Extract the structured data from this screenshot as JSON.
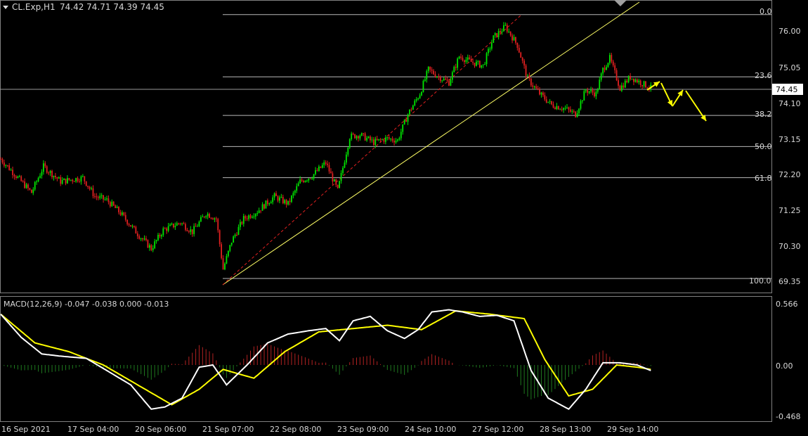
{
  "header": {
    "symbol": "CL.Exp,H1",
    "ohlc": "74.42 74.71 74.39 74.45"
  },
  "colors": {
    "background": "#000000",
    "bull": "#00e600",
    "bear": "#e02020",
    "fib": "#b8b8b8",
    "trend": "#ffff66",
    "signal": "#ffff00",
    "macd_line": "#ffffff",
    "hist_pos": "#b22222",
    "hist_neg": "#1f7a1f",
    "text": "#d8d8d8",
    "price_box_bg": "#ffffff"
  },
  "price_axis": {
    "ticks": [
      "76.00",
      "75.05",
      "74.10",
      "73.15",
      "72.20",
      "71.25",
      "70.30",
      "69.35"
    ],
    "current": "74.45"
  },
  "fib_levels": [
    "0.0",
    "23.6",
    "38.2",
    "50.0",
    "61.8",
    "100.0"
  ],
  "macd": {
    "label": "MACD(12,26,9) -0.047 -0.038 0.000 -0.013",
    "ticks": [
      "0.566",
      "0.00",
      "-0.468"
    ]
  },
  "time_axis": {
    "labels": [
      "16 Sep 2021",
      "17 Sep 04:00",
      "20 Sep 06:00",
      "21 Sep 07:00",
      "22 Sep 08:00",
      "23 Sep 09:00",
      "24 Sep 10:00",
      "27 Sep 12:00",
      "28 Sep 13:00",
      "29 Sep 14:00"
    ]
  },
  "chart_data": {
    "type": "candlestick",
    "price_range": [
      69.35,
      76.3
    ],
    "fib_retracement": {
      "levels": [
        0.0,
        23.6,
        38.2,
        50.0,
        61.8,
        100.0
      ],
      "high": 76.42,
      "low": 69.35
    },
    "trend_line": {
      "from": {
        "bar": 0,
        "price": 69.35
      },
      "to": {
        "bar": 1,
        "price": 76.85
      }
    },
    "close_path": [
      [
        0,
        72.55
      ],
      [
        10,
        72.05
      ],
      [
        18,
        71.65
      ],
      [
        25,
        72.35
      ],
      [
        35,
        71.95
      ],
      [
        48,
        72.05
      ],
      [
        55,
        71.55
      ],
      [
        62,
        71.45
      ],
      [
        70,
        71.1
      ],
      [
        80,
        70.55
      ],
      [
        88,
        70.15
      ],
      [
        95,
        70.65
      ],
      [
        105,
        70.85
      ],
      [
        112,
        70.6
      ],
      [
        120,
        71.1
      ],
      [
        126,
        70.95
      ],
      [
        130,
        69.6
      ],
      [
        135,
        70.35
      ],
      [
        142,
        70.95
      ],
      [
        150,
        71.15
      ],
      [
        160,
        71.55
      ],
      [
        168,
        71.35
      ],
      [
        175,
        71.95
      ],
      [
        182,
        72.1
      ],
      [
        190,
        72.45
      ],
      [
        197,
        71.7
      ],
      [
        204,
        73.15
      ],
      [
        210,
        73.2
      ],
      [
        218,
        73.0
      ],
      [
        226,
        73.1
      ],
      [
        232,
        73.05
      ],
      [
        238,
        73.75
      ],
      [
        245,
        74.3
      ],
      [
        250,
        74.95
      ],
      [
        256,
        74.75
      ],
      [
        262,
        74.6
      ],
      [
        268,
        75.3
      ],
      [
        275,
        75.15
      ],
      [
        282,
        75.05
      ],
      [
        288,
        75.8
      ],
      [
        295,
        76.1
      ],
      [
        302,
        75.6
      ],
      [
        308,
        74.7
      ],
      [
        315,
        74.3
      ],
      [
        322,
        74.0
      ],
      [
        330,
        73.9
      ],
      [
        336,
        73.75
      ],
      [
        342,
        74.4
      ],
      [
        348,
        74.3
      ],
      [
        352,
        74.95
      ],
      [
        356,
        75.25
      ],
      [
        362,
        74.45
      ],
      [
        368,
        74.75
      ],
      [
        374,
        74.6
      ],
      [
        380,
        74.45
      ]
    ],
    "macd_series": {
      "macd_pts": [
        [
          0,
          0.46
        ],
        [
          12,
          0.25
        ],
        [
          24,
          0.1
        ],
        [
          35,
          0.08
        ],
        [
          50,
          0.06
        ],
        [
          62,
          -0.05
        ],
        [
          76,
          -0.18
        ],
        [
          88,
          -0.4
        ],
        [
          96,
          -0.38
        ],
        [
          106,
          -0.3
        ],
        [
          116,
          -0.02
        ],
        [
          124,
          0.0
        ],
        [
          132,
          -0.18
        ],
        [
          144,
          0.0
        ],
        [
          156,
          0.2
        ],
        [
          168,
          0.28
        ],
        [
          180,
          0.31
        ],
        [
          190,
          0.33
        ],
        [
          198,
          0.22
        ],
        [
          206,
          0.4
        ],
        [
          216,
          0.44
        ],
        [
          226,
          0.31
        ],
        [
          236,
          0.24
        ],
        [
          244,
          0.32
        ],
        [
          252,
          0.48
        ],
        [
          262,
          0.5
        ],
        [
          270,
          0.48
        ],
        [
          280,
          0.44
        ],
        [
          290,
          0.45
        ],
        [
          300,
          0.4
        ],
        [
          310,
          -0.05
        ],
        [
          320,
          -0.3
        ],
        [
          332,
          -0.4
        ],
        [
          342,
          -0.22
        ],
        [
          352,
          0.02
        ],
        [
          362,
          0.02
        ],
        [
          372,
          0.0
        ],
        [
          380,
          -0.05
        ]
      ],
      "signal_pts": [
        [
          0,
          0.46
        ],
        [
          20,
          0.2
        ],
        [
          40,
          0.12
        ],
        [
          60,
          0.0
        ],
        [
          80,
          -0.18
        ],
        [
          100,
          -0.36
        ],
        [
          116,
          -0.22
        ],
        [
          130,
          -0.04
        ],
        [
          148,
          -0.12
        ],
        [
          166,
          0.12
        ],
        [
          186,
          0.3
        ],
        [
          206,
          0.33
        ],
        [
          226,
          0.36
        ],
        [
          246,
          0.32
        ],
        [
          266,
          0.49
        ],
        [
          286,
          0.46
        ],
        [
          306,
          0.42
        ],
        [
          318,
          0.05
        ],
        [
          332,
          -0.28
        ],
        [
          346,
          -0.22
        ],
        [
          360,
          0.0
        ],
        [
          372,
          -0.02
        ],
        [
          380,
          -0.04
        ]
      ]
    },
    "macd_range": [
      -0.468,
      0.566
    ]
  }
}
